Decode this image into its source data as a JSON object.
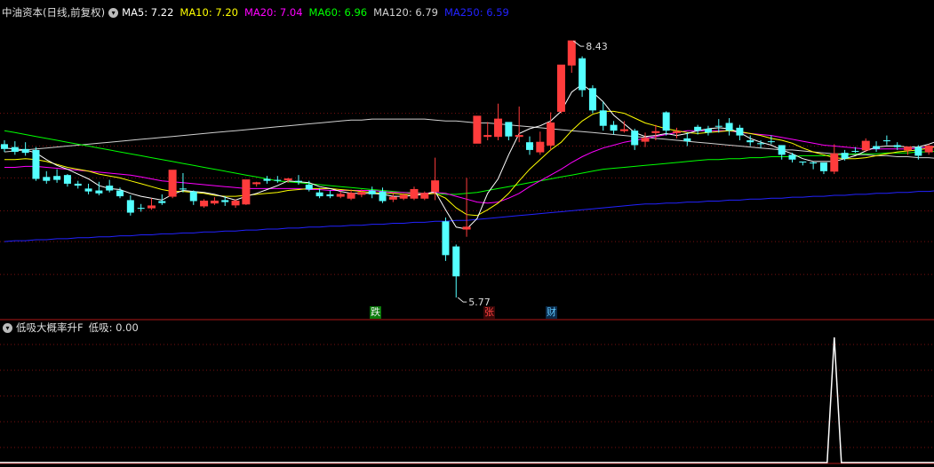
{
  "main_header": {
    "title": "中油资本(日线,前复权)",
    "collapse_icon": "chevron-down-icon",
    "ma": [
      {
        "label": "MA5: 7.22",
        "color": "#ffffff"
      },
      {
        "label": "MA10: 7.20",
        "color": "#ffff00"
      },
      {
        "label": "MA20: 7.04",
        "color": "#ff00ff"
      },
      {
        "label": "MA60: 6.96",
        "color": "#00ff00"
      },
      {
        "label": "MA120: 6.79",
        "color": "#d0d0d0"
      },
      {
        "label": "MA250: 6.59",
        "color": "#2222ff"
      }
    ]
  },
  "annotations": {
    "high_label": "8.43",
    "low_label": "5.77",
    "tag_die": "跌",
    "tag_zhang": "张",
    "tag_cai": "财"
  },
  "indicator_header": {
    "name": "低吸大概率升F",
    "value_label": "低吸: 0.00"
  },
  "colors": {
    "up": "#ff3c3c",
    "down": "#54ffff",
    "grid": "#7a1010",
    "background": "#000000"
  },
  "chart_data": {
    "type": "candlestick",
    "title": "中油资本(日线,前复权)",
    "candles": [
      [
        7.36,
        7.4,
        7.31,
        7.28
      ],
      [
        7.33,
        7.39,
        7.28,
        7.25
      ],
      [
        7.31,
        7.38,
        7.27,
        7.24
      ],
      [
        7.3,
        7.33,
        7.0,
        6.98
      ],
      [
        7.02,
        7.08,
        6.98,
        6.95
      ],
      [
        7.03,
        7.1,
        6.99,
        6.96
      ],
      [
        7.04,
        7.05,
        6.95,
        6.92
      ],
      [
        6.95,
        6.98,
        6.93,
        6.9
      ],
      [
        6.9,
        6.95,
        6.87,
        6.84
      ],
      [
        6.88,
        6.97,
        6.85,
        6.83
      ],
      [
        6.93,
        6.99,
        6.88,
        6.86
      ],
      [
        6.88,
        6.91,
        6.82,
        6.8
      ],
      [
        6.78,
        6.83,
        6.65,
        6.62
      ],
      [
        6.7,
        6.74,
        6.69,
        6.66
      ],
      [
        6.7,
        6.8,
        6.72,
        6.68
      ],
      [
        6.77,
        6.84,
        6.75,
        6.73
      ],
      [
        6.82,
        7.09,
        7.09,
        6.8
      ],
      [
        6.9,
        7.06,
        6.9,
        6.86
      ],
      [
        6.87,
        6.88,
        6.77,
        6.73
      ],
      [
        6.72,
        6.79,
        6.77,
        6.7
      ],
      [
        6.75,
        6.81,
        6.77,
        6.73
      ],
      [
        6.78,
        6.82,
        6.76,
        6.72
      ],
      [
        6.73,
        6.79,
        6.77,
        6.7
      ],
      [
        6.74,
        6.95,
        6.99,
        6.73
      ],
      [
        6.95,
        6.97,
        6.96,
        6.92
      ],
      [
        7.0,
        7.03,
        6.98,
        6.95
      ],
      [
        6.99,
        7.03,
        6.98,
        6.96
      ],
      [
        6.99,
        7.01,
        7.0,
        6.96
      ],
      [
        6.98,
        7.04,
        6.97,
        6.94
      ],
      [
        6.94,
        6.98,
        6.89,
        6.87
      ],
      [
        6.86,
        6.9,
        6.82,
        6.8
      ],
      [
        6.84,
        6.88,
        6.82,
        6.8
      ],
      [
        6.82,
        6.87,
        6.84,
        6.8
      ],
      [
        6.8,
        6.89,
        6.85,
        6.78
      ],
      [
        6.84,
        6.89,
        6.86,
        6.81
      ],
      [
        6.88,
        6.92,
        6.84,
        6.8
      ],
      [
        6.87,
        6.91,
        6.77,
        6.75
      ],
      [
        6.79,
        6.85,
        6.81,
        6.76
      ],
      [
        6.8,
        6.85,
        6.83,
        6.78
      ],
      [
        6.8,
        6.92,
        6.89,
        6.78
      ],
      [
        6.8,
        6.87,
        6.85,
        6.78
      ],
      [
        6.87,
        7.22,
        6.98,
        6.78
      ],
      [
        6.56,
        6.6,
        6.21,
        6.15
      ],
      [
        6.3,
        6.32,
        5.99,
        5.77
      ],
      [
        6.48,
        7.01,
        6.5,
        6.4
      ],
      [
        7.37,
        7.52,
        7.65,
        7.37
      ],
      [
        7.44,
        7.59,
        7.45,
        7.4
      ],
      [
        7.44,
        7.78,
        7.62,
        7.4
      ],
      [
        7.59,
        7.54,
        7.44,
        7.4
      ],
      [
        7.44,
        7.75,
        7.45,
        7.38
      ],
      [
        7.38,
        7.44,
        7.3,
        7.25
      ],
      [
        7.28,
        7.49,
        7.38,
        7.25
      ],
      [
        7.35,
        7.69,
        7.58,
        7.3
      ],
      [
        7.7,
        8.18,
        8.18,
        7.68
      ],
      [
        8.18,
        8.43,
        8.43,
        8.1
      ],
      [
        8.25,
        8.27,
        7.92,
        7.85
      ],
      [
        7.94,
        7.97,
        7.71,
        7.68
      ],
      [
        7.71,
        7.8,
        7.55,
        7.5
      ],
      [
        7.56,
        7.6,
        7.5,
        7.46
      ],
      [
        7.5,
        7.6,
        7.51,
        7.48
      ],
      [
        7.5,
        7.52,
        7.35,
        7.3
      ],
      [
        7.39,
        7.48,
        7.42,
        7.33
      ],
      [
        7.48,
        7.56,
        7.49,
        7.4
      ],
      [
        7.69,
        7.7,
        7.5,
        7.45
      ],
      [
        7.48,
        7.53,
        7.49,
        7.42
      ],
      [
        7.42,
        7.48,
        7.39,
        7.34
      ],
      [
        7.54,
        7.56,
        7.5,
        7.46
      ],
      [
        7.52,
        7.55,
        7.48,
        7.45
      ],
      [
        7.55,
        7.62,
        7.55,
        7.48
      ],
      [
        7.58,
        7.63,
        7.5,
        7.45
      ],
      [
        7.53,
        7.56,
        7.45,
        7.4
      ],
      [
        7.4,
        7.45,
        7.38,
        7.34
      ],
      [
        7.37,
        7.4,
        7.36,
        7.32
      ],
      [
        7.39,
        7.45,
        7.39,
        7.36
      ],
      [
        7.35,
        7.35,
        7.25,
        7.2
      ],
      [
        7.25,
        7.27,
        7.2,
        7.17
      ],
      [
        7.18,
        7.18,
        7.17,
        7.14
      ],
      [
        7.17,
        7.18,
        7.16,
        7.1
      ],
      [
        7.17,
        7.17,
        7.08,
        7.05
      ],
      [
        7.08,
        7.36,
        7.26,
        7.05
      ],
      [
        7.27,
        7.3,
        7.21,
        7.19
      ],
      [
        7.29,
        7.33,
        7.29,
        7.27
      ],
      [
        7.3,
        7.42,
        7.39,
        7.28
      ],
      [
        7.34,
        7.39,
        7.31,
        7.28
      ],
      [
        7.4,
        7.45,
        7.39,
        7.35
      ],
      [
        7.35,
        7.38,
        7.33,
        7.3
      ],
      [
        7.3,
        7.33,
        7.33,
        7.25
      ],
      [
        7.33,
        7.35,
        7.24,
        7.2
      ],
      [
        7.28,
        7.36,
        7.34,
        7.25
      ],
      [
        7.35,
        7.58,
        7.42,
        7.3
      ],
      [
        7.4,
        7.58,
        7.6,
        7.35
      ],
      [
        7.59,
        7.85,
        7.8,
        7.55
      ],
      [
        7.8,
        8.22,
        7.6,
        7.6
      ],
      [
        7.65,
        7.7,
        7.4,
        7.38
      ],
      [
        7.42,
        7.55,
        7.52,
        7.35
      ],
      [
        7.43,
        7.51,
        7.46,
        7.4
      ],
      [
        7.46,
        7.63,
        7.63,
        7.43
      ],
      [
        7.57,
        7.65,
        7.64,
        7.55
      ],
      [
        7.56,
        7.69,
        7.74,
        7.56
      ]
    ],
    "ma_series": {
      "MA5": [
        7.32,
        7.31,
        7.3,
        7.27,
        7.2,
        7.14,
        7.1,
        7.05,
        7.0,
        6.93,
        6.9,
        6.89,
        6.85,
        6.82,
        6.8,
        6.78,
        6.84,
        6.88,
        6.87,
        6.86,
        6.84,
        6.81,
        6.78,
        6.82,
        6.85,
        6.89,
        6.93,
        6.98,
        6.97,
        6.96,
        6.92,
        6.9,
        6.87,
        6.85,
        6.85,
        6.85,
        6.84,
        6.82,
        6.82,
        6.83,
        6.84,
        6.87,
        6.68,
        6.5,
        6.48,
        6.59,
        6.85,
        7.0,
        7.25,
        7.47,
        7.52,
        7.55,
        7.6,
        7.7,
        7.9,
        7.98,
        7.9,
        7.8,
        7.66,
        7.57,
        7.48,
        7.44,
        7.45,
        7.47,
        7.45,
        7.47,
        7.5,
        7.52,
        7.53,
        7.52,
        7.48,
        7.42,
        7.38,
        7.35,
        7.3,
        7.26,
        7.21,
        7.18,
        7.18,
        7.18,
        7.21,
        7.24,
        7.29,
        7.33,
        7.34,
        7.34,
        7.33,
        7.33,
        7.36,
        7.4,
        7.5,
        7.55,
        7.58,
        7.59,
        7.58,
        7.59,
        7.62,
        7.66
      ],
      "MA10": [
        7.2,
        7.2,
        7.21,
        7.2,
        7.18,
        7.15,
        7.12,
        7.1,
        7.08,
        7.05,
        7.03,
        7.01,
        6.98,
        6.95,
        6.92,
        6.89,
        6.87,
        6.87,
        6.86,
        6.85,
        6.83,
        6.82,
        6.82,
        6.83,
        6.84,
        6.85,
        6.86,
        6.88,
        6.89,
        6.9,
        6.9,
        6.9,
        6.89,
        6.88,
        6.87,
        6.86,
        6.85,
        6.85,
        6.84,
        6.84,
        6.84,
        6.85,
        6.8,
        6.7,
        6.63,
        6.62,
        6.68,
        6.75,
        6.85,
        6.98,
        7.1,
        7.2,
        7.3,
        7.38,
        7.5,
        7.6,
        7.67,
        7.7,
        7.7,
        7.68,
        7.63,
        7.58,
        7.55,
        7.52,
        7.5,
        7.48,
        7.47,
        7.48,
        7.49,
        7.5,
        7.49,
        7.47,
        7.45,
        7.42,
        7.4,
        7.37,
        7.32,
        7.28,
        7.25,
        7.22,
        7.21,
        7.21,
        7.22,
        7.24,
        7.26,
        7.28,
        7.29,
        7.3,
        7.32,
        7.34,
        7.38,
        7.42,
        7.45,
        7.48,
        7.5,
        7.52,
        7.55,
        7.58
      ],
      "MA20": [
        7.12,
        7.12,
        7.13,
        7.13,
        7.12,
        7.11,
        7.1,
        7.09,
        7.08,
        7.07,
        7.06,
        7.05,
        7.04,
        7.02,
        7.0,
        6.98,
        6.97,
        6.96,
        6.95,
        6.94,
        6.93,
        6.92,
        6.91,
        6.9,
        6.9,
        6.9,
        6.9,
        6.9,
        6.9,
        6.89,
        6.89,
        6.88,
        6.88,
        6.88,
        6.88,
        6.88,
        6.87,
        6.86,
        6.86,
        6.85,
        6.85,
        6.86,
        6.85,
        6.82,
        6.79,
        6.76,
        6.75,
        6.76,
        6.8,
        6.85,
        6.92,
        6.98,
        7.04,
        7.1,
        7.17,
        7.23,
        7.28,
        7.32,
        7.35,
        7.38,
        7.4,
        7.42,
        7.44,
        7.46,
        7.48,
        7.5,
        7.5,
        7.5,
        7.5,
        7.5,
        7.48,
        7.47,
        7.46,
        7.45,
        7.43,
        7.41,
        7.39,
        7.37,
        7.35,
        7.34,
        7.33,
        7.32,
        7.31,
        7.31,
        7.31,
        7.31,
        7.31,
        7.32,
        7.33,
        7.34,
        7.35,
        7.37,
        7.39,
        7.41,
        7.43,
        7.45,
        7.47,
        7.5
      ],
      "MA60": [
        7.5,
        7.48,
        7.46,
        7.44,
        7.42,
        7.4,
        7.38,
        7.36,
        7.34,
        7.32,
        7.3,
        7.28,
        7.26,
        7.24,
        7.22,
        7.2,
        7.18,
        7.16,
        7.14,
        7.12,
        7.1,
        7.08,
        7.06,
        7.04,
        7.02,
        7.0,
        6.98,
        6.97,
        6.96,
        6.95,
        6.94,
        6.93,
        6.92,
        6.91,
        6.9,
        6.89,
        6.88,
        6.87,
        6.86,
        6.86,
        6.85,
        6.85,
        6.84,
        6.84,
        6.85,
        6.86,
        6.88,
        6.9,
        6.92,
        6.94,
        6.96,
        6.98,
        7.0,
        7.02,
        7.04,
        7.06,
        7.08,
        7.1,
        7.11,
        7.12,
        7.13,
        7.14,
        7.15,
        7.16,
        7.17,
        7.18,
        7.19,
        7.2,
        7.2,
        7.21,
        7.21,
        7.22,
        7.22,
        7.23,
        7.23,
        7.23,
        7.24,
        7.24,
        7.24,
        7.25,
        7.25,
        7.26,
        7.26,
        7.26,
        7.27,
        7.27,
        7.27,
        7.28,
        7.28,
        7.29,
        7.29,
        7.3,
        7.3,
        7.31,
        7.32,
        7.33,
        7.34,
        7.35
      ],
      "MA120": [
        7.28,
        7.29,
        7.3,
        7.31,
        7.32,
        7.33,
        7.34,
        7.35,
        7.36,
        7.37,
        7.38,
        7.39,
        7.4,
        7.41,
        7.42,
        7.43,
        7.44,
        7.45,
        7.46,
        7.47,
        7.48,
        7.49,
        7.5,
        7.51,
        7.52,
        7.53,
        7.54,
        7.55,
        7.56,
        7.57,
        7.58,
        7.59,
        7.6,
        7.61,
        7.61,
        7.62,
        7.62,
        7.62,
        7.62,
        7.62,
        7.62,
        7.61,
        7.6,
        7.6,
        7.59,
        7.58,
        7.58,
        7.57,
        7.56,
        7.55,
        7.54,
        7.53,
        7.52,
        7.51,
        7.5,
        7.49,
        7.48,
        7.47,
        7.46,
        7.45,
        7.44,
        7.43,
        7.42,
        7.41,
        7.4,
        7.39,
        7.38,
        7.37,
        7.36,
        7.35,
        7.34,
        7.33,
        7.32,
        7.31,
        7.3,
        7.3,
        7.29,
        7.28,
        7.27,
        7.26,
        7.26,
        7.25,
        7.25,
        7.24,
        7.24,
        7.23,
        7.23,
        7.22,
        7.22,
        7.21,
        7.21,
        7.2,
        7.2,
        7.19,
        7.19,
        7.18,
        7.18,
        7.18
      ],
      "MA250": [
        6.35,
        6.36,
        6.36,
        6.37,
        6.37,
        6.38,
        6.38,
        6.39,
        6.39,
        6.4,
        6.4,
        6.41,
        6.41,
        6.42,
        6.42,
        6.43,
        6.43,
        6.44,
        6.44,
        6.45,
        6.45,
        6.46,
        6.46,
        6.47,
        6.47,
        6.48,
        6.48,
        6.49,
        6.49,
        6.5,
        6.5,
        6.51,
        6.51,
        6.52,
        6.52,
        6.53,
        6.53,
        6.54,
        6.54,
        6.55,
        6.55,
        6.56,
        6.56,
        6.57,
        6.57,
        6.58,
        6.59,
        6.6,
        6.61,
        6.62,
        6.63,
        6.64,
        6.65,
        6.66,
        6.67,
        6.68,
        6.69,
        6.7,
        6.71,
        6.72,
        6.73,
        6.74,
        6.74,
        6.75,
        6.75,
        6.76,
        6.76,
        6.77,
        6.77,
        6.78,
        6.78,
        6.79,
        6.79,
        6.8,
        6.8,
        6.81,
        6.81,
        6.82,
        6.82,
        6.83,
        6.83,
        6.84,
        6.84,
        6.85,
        6.85,
        6.86,
        6.86,
        6.87,
        6.87,
        6.88,
        6.88,
        6.89,
        6.89,
        6.9,
        6.9,
        6.91,
        6.92,
        6.93
      ]
    },
    "indicator": {
      "name": "低吸",
      "spike_index": 79,
      "spike_value": 1,
      "values_note": "all 0 except spike"
    }
  }
}
